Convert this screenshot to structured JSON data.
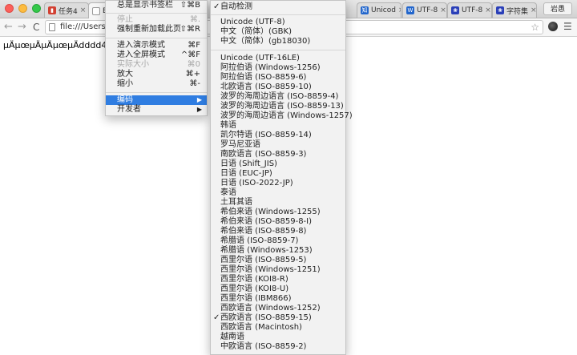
{
  "tabs": [
    {
      "label": "任务4",
      "favicon_color": "#d23f31"
    },
    {
      "label": "Ex",
      "favicon_color": "#888888"
    },
    {
      "label": "Unicod",
      "favicon_color": "#2266cc"
    },
    {
      "label": "UTF-8",
      "favicon_color": "#2266cc"
    },
    {
      "label": "UTF-8",
      "favicon_color": "#2a3fb8"
    },
    {
      "label": "字符集",
      "favicon_color": "#2a3fb8"
    }
  ],
  "tab_close_glyph": "×",
  "profile_label": "岩愚",
  "address_bar": {
    "url": "file:///Users/"
  },
  "page_text": "µÄµœµÄµÄµœµÄdddd44",
  "view_menu": {
    "items": [
      {
        "label": "总是显示书签栏",
        "shortcut": "⇧⌘B",
        "disabled": false
      },
      {
        "label": "停止",
        "shortcut": "⌘.",
        "disabled": true
      },
      {
        "label": "强制重新加载此页",
        "shortcut": "⇧⌘R",
        "disabled": false
      },
      {
        "label": "进入演示模式",
        "shortcut": "⌘F",
        "disabled": false
      },
      {
        "label": "进入全屏模式",
        "shortcut": "^⌘F",
        "disabled": false
      },
      {
        "label": "实际大小",
        "shortcut": "⌘0",
        "disabled": true
      },
      {
        "label": "放大",
        "shortcut": "⌘+",
        "disabled": false
      },
      {
        "label": "缩小",
        "shortcut": "⌘-",
        "disabled": false
      },
      {
        "label": "编码",
        "shortcut": "",
        "disabled": false
      },
      {
        "label": "开发者",
        "shortcut": "",
        "disabled": false
      }
    ],
    "submenu_arrow": "▶"
  },
  "encoding_menu": {
    "check_glyph": "✓",
    "items": [
      "自动检测",
      "Unicode (UTF-8)",
      "中文（简体）(GBK)",
      "中文（简体）(gb18030)",
      "Unicode (UTF-16LE)",
      "阿拉伯语 (Windows-1256)",
      "阿拉伯语 (ISO-8859-6)",
      "北欧语言 (ISO-8859-10)",
      "波罗的海周边语言 (ISO-8859-4)",
      "波罗的海周边语言 (ISO-8859-13)",
      "波罗的海周边语言 (Windows-1257)",
      "韩语",
      "凯尔特语 (ISO-8859-14)",
      "罗马尼亚语",
      "南欧语言 (ISO-8859-3)",
      "日语 (Shift_JIS)",
      "日语 (EUC-JP)",
      "日语 (ISO-2022-JP)",
      "泰语",
      "土耳其语",
      "希伯来语 (Windows-1255)",
      "希伯来语 (ISO-8859-8-I)",
      "希伯来语 (ISO-8859-8)",
      "希腊语 (ISO-8859-7)",
      "希腊语 (Windows-1253)",
      "西里尔语 (ISO-8859-5)",
      "西里尔语 (Windows-1251)",
      "西里尔语 (KOI8-R)",
      "西里尔语 (KOI8-U)",
      "西里尔语 (IBM866)",
      "西欧语言 (Windows-1252)",
      "西欧语言 (ISO-8859-15)",
      "西欧语言 (Macintosh)",
      "越南语",
      "中欧语言 (ISO-8859-2)"
    ],
    "checked": [
      "自动检测",
      "西欧语言 (ISO-8859-15)"
    ]
  },
  "colors": {
    "highlight": "#2f7de1",
    "traffic_red": "#fc605b",
    "traffic_yellow": "#fdbc40",
    "traffic_green": "#34c84a"
  }
}
